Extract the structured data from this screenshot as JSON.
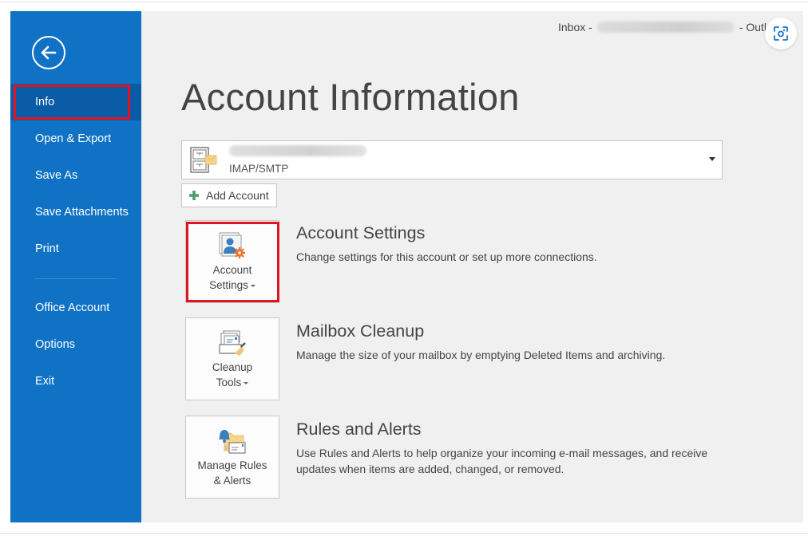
{
  "window": {
    "title_prefix": "Inbox -",
    "title_suffix": "- Outlook",
    "redacted_account": true
  },
  "sidebar": {
    "back_label": "Back",
    "items": [
      {
        "label": "Info",
        "active": true
      },
      {
        "label": "Open & Export",
        "active": false
      },
      {
        "label": "Save As",
        "active": false
      },
      {
        "label": "Save Attachments",
        "active": false
      },
      {
        "label": "Print",
        "active": false
      },
      {
        "label": "Office Account",
        "active": false
      },
      {
        "label": "Options",
        "active": false
      },
      {
        "label": "Exit",
        "active": false
      }
    ]
  },
  "main": {
    "title": "Account Information",
    "account_selector": {
      "type": "IMAP/SMTP",
      "email_redacted": true
    },
    "add_account_label": "Add Account",
    "sections": [
      {
        "button_line1": "Account",
        "button_line2": "Settings",
        "has_dropdown": true,
        "title": "Account Settings",
        "description": "Change settings for this account or set up more connections.",
        "highlighted": true
      },
      {
        "button_line1": "Cleanup",
        "button_line2": "Tools",
        "has_dropdown": true,
        "title": "Mailbox Cleanup",
        "description": "Manage the size of your mailbox by emptying Deleted Items and archiving.",
        "highlighted": false
      },
      {
        "button_line1": "Manage Rules",
        "button_line2": "& Alerts",
        "has_dropdown": false,
        "title": "Rules and Alerts",
        "description": "Use Rules and Alerts to help organize your incoming e-mail messages, and receive updates when items are added, changed, or removed.",
        "highlighted": false
      }
    ]
  },
  "colors": {
    "sidebar_bg": "#0f72c5",
    "sidebar_active": "#0a5ca6",
    "highlight_border": "#e0141e",
    "content_bg": "#f0f0f0"
  }
}
